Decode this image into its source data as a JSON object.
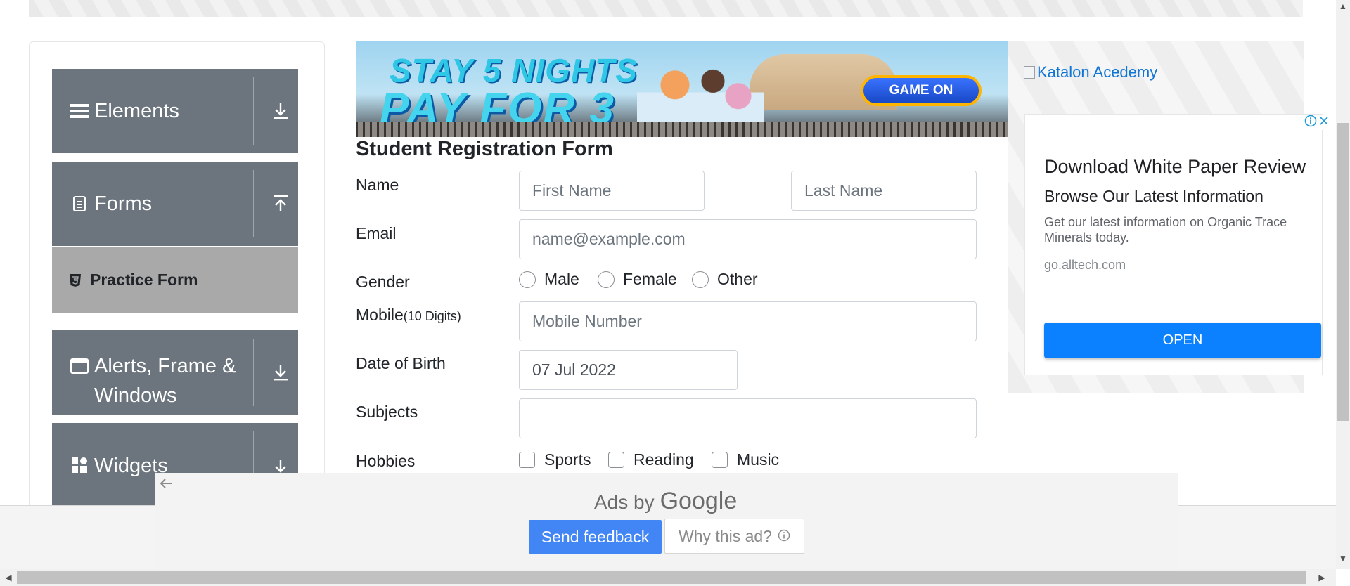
{
  "sidebar": {
    "groups": [
      {
        "title": "Elements",
        "icon": "hamburger-icon",
        "toggle_icon": "download-arrow-icon"
      },
      {
        "title": "Forms",
        "icon": "document-icon",
        "toggle_icon": "upload-arrow-icon"
      },
      {
        "title": "Alerts, Frame &",
        "title_line2": "Windows",
        "icon": "window-icon",
        "toggle_icon": "download-arrow-icon"
      },
      {
        "title": "Widgets",
        "icon": "widgets-icon",
        "toggle_icon": "download-arrow-icon"
      }
    ],
    "active_item": {
      "label": "Practice Form",
      "icon": "html5-icon"
    }
  },
  "banner": {
    "line1": "STAY 5 NIGHTS",
    "line2": "PAY FOR 3",
    "cta": "GAME ON"
  },
  "form": {
    "title": "Student Registration Form",
    "name_label": "Name",
    "first_name_placeholder": "First Name",
    "last_name_placeholder": "Last Name",
    "email_label": "Email",
    "email_placeholder": "name@example.com",
    "gender_label": "Gender",
    "gender_options": [
      "Male",
      "Female",
      "Other"
    ],
    "mobile_label": "Mobile",
    "mobile_hint": "(10 Digits)",
    "mobile_placeholder": "Mobile Number",
    "dob_label": "Date of Birth",
    "dob_value": "07 Jul 2022",
    "subjects_label": "Subjects",
    "subjects_value": "",
    "hobbies_label": "Hobbies",
    "hobbies_options": [
      "Sports",
      "Reading",
      "Music"
    ]
  },
  "right_ad": {
    "image_alt": "Katalon Acedemy",
    "headline": "Download White Paper Review",
    "subheadline": "Browse Our Latest Information",
    "body": "Get our latest information on Organic Trace Minerals today.",
    "url": "go.alltech.com",
    "cta": "OPEN"
  },
  "google_ad": {
    "ads_by": "Ads by",
    "brand": "Google",
    "send_feedback": "Send feedback",
    "why_this_ad": "Why this ad?"
  },
  "colors": {
    "sidebar_header": "#6c757d",
    "active_item": "#a9a9a9",
    "ad_button": "#0b81ff",
    "feedback_button": "#4285f4"
  }
}
